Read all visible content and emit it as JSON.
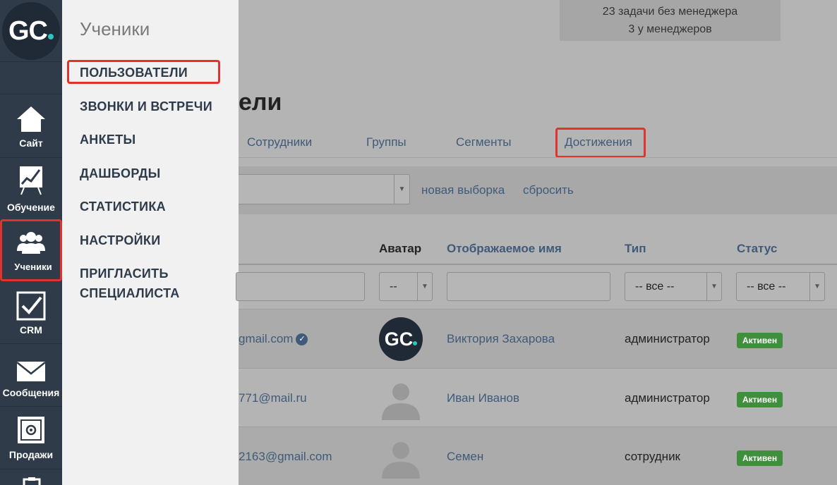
{
  "rail": {
    "logo": "GC",
    "items": [
      {
        "label": "Сайт",
        "icon": "home-icon"
      },
      {
        "label": "Обучение",
        "icon": "chart-board-icon"
      },
      {
        "label": "Ученики",
        "icon": "users-icon"
      },
      {
        "label": "CRM",
        "icon": "checkbox-icon"
      },
      {
        "label": "Сообщения",
        "icon": "envelope-icon"
      },
      {
        "label": "Продажи",
        "icon": "safe-icon"
      }
    ]
  },
  "flyout": {
    "title": "Ученики",
    "items": [
      "ПОЛЬЗОВАТЕЛИ",
      "ЗВОНКИ И ВСТРЕЧИ",
      "АНКЕТЫ",
      "ДАШБОРДЫ",
      "СТАТИСТИКА",
      "НАСТРОЙКИ",
      "ПРИГЛАСИТЬ",
      "СПЕЦИАЛИСТА"
    ]
  },
  "main": {
    "tasks_line1": "23 задачи без менеджера",
    "tasks_line2": "3 у менеджеров",
    "title": "ели",
    "tabs": [
      "Сотрудники",
      "Группы",
      "Сегменты",
      "Достижения"
    ],
    "filter_links": [
      "новая выборка",
      "сбросить"
    ],
    "columns": [
      "Аватар",
      "Отображаемое имя",
      "Тип",
      "Статус"
    ],
    "filters": {
      "avatar": "--",
      "type": "-- все --",
      "status": "-- все --"
    },
    "rows": [
      {
        "email": "gmail.com",
        "name": "Виктория Захарова",
        "type": "администратор",
        "status": "Активен",
        "avatar": "GC"
      },
      {
        "email": "771@mail.ru",
        "name": "Иван Иванов",
        "type": "администратор",
        "status": "Активен",
        "avatar": ""
      },
      {
        "email": "2163@gmail.com",
        "name": "Семен",
        "type": "сотрудник",
        "status": "Активен",
        "avatar": ""
      }
    ]
  },
  "colors": {
    "rail_bg": "#2f3b49",
    "highlight": "#e0322e",
    "active_badge": "#3f8f3c",
    "link": "#3f5a7a"
  }
}
